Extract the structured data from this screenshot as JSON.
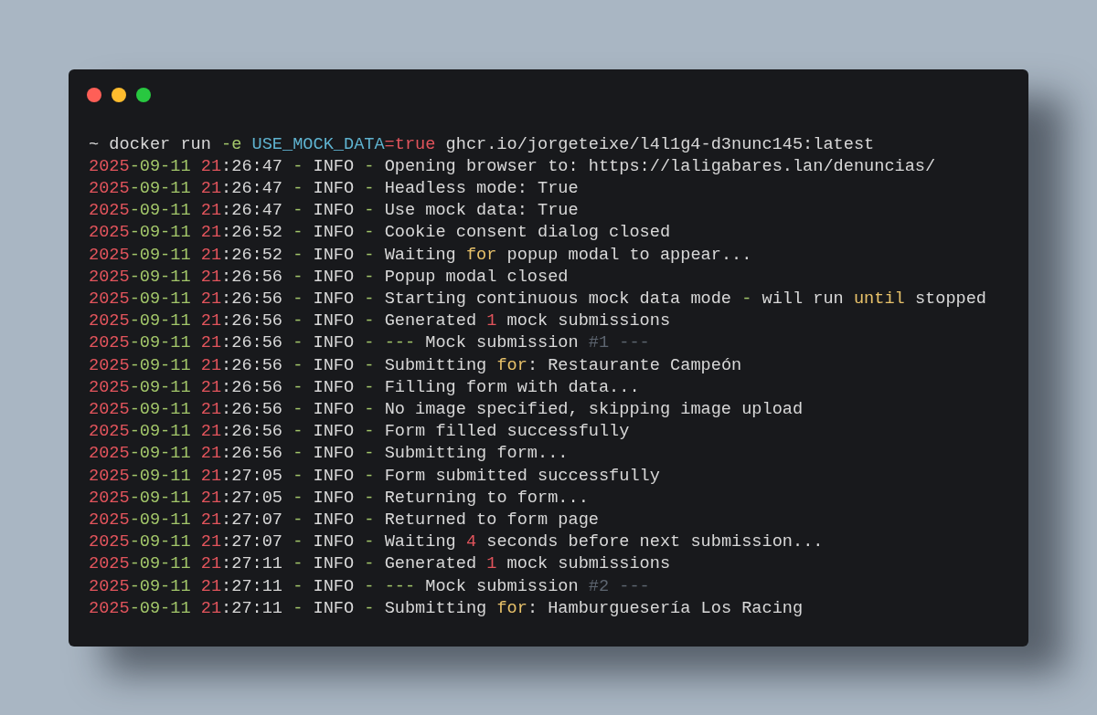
{
  "window": {
    "controls": [
      {
        "color": "#fe5f57"
      },
      {
        "color": "#febc2e"
      },
      {
        "color": "#28c840"
      }
    ]
  },
  "terminal": {
    "lines": [
      {
        "tokens": [
          {
            "kind": "plain",
            "text": "~ docker run "
          },
          {
            "kind": "op",
            "text": "-e "
          },
          {
            "kind": "var",
            "text": "USE_MOCK_DATA"
          },
          {
            "kind": "num",
            "text": "=true"
          },
          {
            "kind": "plain",
            "text": " ghcr.io/jorgeteixe/l4l1g4-d3nunc145:latest"
          }
        ]
      },
      {
        "tokens": [
          {
            "kind": "num",
            "text": "2025"
          },
          {
            "kind": "op",
            "text": "-09-11 "
          },
          {
            "kind": "num",
            "text": "21"
          },
          {
            "kind": "plain",
            "text": ":26:47 "
          },
          {
            "kind": "op",
            "text": "-"
          },
          {
            "kind": "plain",
            "text": " INFO "
          },
          {
            "kind": "op",
            "text": "-"
          },
          {
            "kind": "plain",
            "text": " Opening browser to: https://laligabares.lan/denuncias/"
          }
        ]
      },
      {
        "tokens": [
          {
            "kind": "num",
            "text": "2025"
          },
          {
            "kind": "op",
            "text": "-09-11 "
          },
          {
            "kind": "num",
            "text": "21"
          },
          {
            "kind": "plain",
            "text": ":26:47 "
          },
          {
            "kind": "op",
            "text": "-"
          },
          {
            "kind": "plain",
            "text": " INFO "
          },
          {
            "kind": "op",
            "text": "-"
          },
          {
            "kind": "plain",
            "text": " Headless mode: True"
          }
        ]
      },
      {
        "tokens": [
          {
            "kind": "num",
            "text": "2025"
          },
          {
            "kind": "op",
            "text": "-09-11 "
          },
          {
            "kind": "num",
            "text": "21"
          },
          {
            "kind": "plain",
            "text": ":26:47 "
          },
          {
            "kind": "op",
            "text": "-"
          },
          {
            "kind": "plain",
            "text": " INFO "
          },
          {
            "kind": "op",
            "text": "-"
          },
          {
            "kind": "plain",
            "text": " Use mock data: True"
          }
        ]
      },
      {
        "tokens": [
          {
            "kind": "num",
            "text": "2025"
          },
          {
            "kind": "op",
            "text": "-09-11 "
          },
          {
            "kind": "num",
            "text": "21"
          },
          {
            "kind": "plain",
            "text": ":26:52 "
          },
          {
            "kind": "op",
            "text": "-"
          },
          {
            "kind": "plain",
            "text": " INFO "
          },
          {
            "kind": "op",
            "text": "-"
          },
          {
            "kind": "plain",
            "text": " Cookie consent dialog closed"
          }
        ]
      },
      {
        "tokens": [
          {
            "kind": "num",
            "text": "2025"
          },
          {
            "kind": "op",
            "text": "-09-11 "
          },
          {
            "kind": "num",
            "text": "21"
          },
          {
            "kind": "plain",
            "text": ":26:52 "
          },
          {
            "kind": "op",
            "text": "-"
          },
          {
            "kind": "plain",
            "text": " INFO "
          },
          {
            "kind": "op",
            "text": "-"
          },
          {
            "kind": "plain",
            "text": " Waiting "
          },
          {
            "kind": "kw",
            "text": "for"
          },
          {
            "kind": "plain",
            "text": " popup modal to appear..."
          }
        ]
      },
      {
        "tokens": [
          {
            "kind": "num",
            "text": "2025"
          },
          {
            "kind": "op",
            "text": "-09-11 "
          },
          {
            "kind": "num",
            "text": "21"
          },
          {
            "kind": "plain",
            "text": ":26:56 "
          },
          {
            "kind": "op",
            "text": "-"
          },
          {
            "kind": "plain",
            "text": " INFO "
          },
          {
            "kind": "op",
            "text": "-"
          },
          {
            "kind": "plain",
            "text": " Popup modal closed"
          }
        ]
      },
      {
        "tokens": [
          {
            "kind": "num",
            "text": "2025"
          },
          {
            "kind": "op",
            "text": "-09-11 "
          },
          {
            "kind": "num",
            "text": "21"
          },
          {
            "kind": "plain",
            "text": ":26:56 "
          },
          {
            "kind": "op",
            "text": "-"
          },
          {
            "kind": "plain",
            "text": " INFO "
          },
          {
            "kind": "op",
            "text": "-"
          },
          {
            "kind": "plain",
            "text": " Starting continuous mock data mode "
          },
          {
            "kind": "op",
            "text": "-"
          },
          {
            "kind": "plain",
            "text": " will run "
          },
          {
            "kind": "kw",
            "text": "until"
          },
          {
            "kind": "plain",
            "text": " stopped"
          }
        ]
      },
      {
        "tokens": [
          {
            "kind": "num",
            "text": "2025"
          },
          {
            "kind": "op",
            "text": "-09-11 "
          },
          {
            "kind": "num",
            "text": "21"
          },
          {
            "kind": "plain",
            "text": ":26:56 "
          },
          {
            "kind": "op",
            "text": "-"
          },
          {
            "kind": "plain",
            "text": " INFO "
          },
          {
            "kind": "op",
            "text": "-"
          },
          {
            "kind": "plain",
            "text": " Generated "
          },
          {
            "kind": "num",
            "text": "1"
          },
          {
            "kind": "plain",
            "text": " mock submissions"
          }
        ]
      },
      {
        "tokens": [
          {
            "kind": "num",
            "text": "2025"
          },
          {
            "kind": "op",
            "text": "-09-11 "
          },
          {
            "kind": "num",
            "text": "21"
          },
          {
            "kind": "plain",
            "text": ":26:56 "
          },
          {
            "kind": "op",
            "text": "-"
          },
          {
            "kind": "plain",
            "text": " INFO "
          },
          {
            "kind": "op",
            "text": "- ---"
          },
          {
            "kind": "plain",
            "text": " Mock submission "
          },
          {
            "kind": "comment",
            "text": "#1 ---"
          }
        ]
      },
      {
        "tokens": [
          {
            "kind": "num",
            "text": "2025"
          },
          {
            "kind": "op",
            "text": "-09-11 "
          },
          {
            "kind": "num",
            "text": "21"
          },
          {
            "kind": "plain",
            "text": ":26:56 "
          },
          {
            "kind": "op",
            "text": "-"
          },
          {
            "kind": "plain",
            "text": " INFO "
          },
          {
            "kind": "op",
            "text": "-"
          },
          {
            "kind": "plain",
            "text": " Submitting "
          },
          {
            "kind": "kw",
            "text": "for"
          },
          {
            "kind": "plain",
            "text": ": Restaurante Campeón"
          }
        ]
      },
      {
        "tokens": [
          {
            "kind": "num",
            "text": "2025"
          },
          {
            "kind": "op",
            "text": "-09-11 "
          },
          {
            "kind": "num",
            "text": "21"
          },
          {
            "kind": "plain",
            "text": ":26:56 "
          },
          {
            "kind": "op",
            "text": "-"
          },
          {
            "kind": "plain",
            "text": " INFO "
          },
          {
            "kind": "op",
            "text": "-"
          },
          {
            "kind": "plain",
            "text": " Filling form with data..."
          }
        ]
      },
      {
        "tokens": [
          {
            "kind": "num",
            "text": "2025"
          },
          {
            "kind": "op",
            "text": "-09-11 "
          },
          {
            "kind": "num",
            "text": "21"
          },
          {
            "kind": "plain",
            "text": ":26:56 "
          },
          {
            "kind": "op",
            "text": "-"
          },
          {
            "kind": "plain",
            "text": " INFO "
          },
          {
            "kind": "op",
            "text": "-"
          },
          {
            "kind": "plain",
            "text": " No image specified, skipping image upload"
          }
        ]
      },
      {
        "tokens": [
          {
            "kind": "num",
            "text": "2025"
          },
          {
            "kind": "op",
            "text": "-09-11 "
          },
          {
            "kind": "num",
            "text": "21"
          },
          {
            "kind": "plain",
            "text": ":26:56 "
          },
          {
            "kind": "op",
            "text": "-"
          },
          {
            "kind": "plain",
            "text": " INFO "
          },
          {
            "kind": "op",
            "text": "-"
          },
          {
            "kind": "plain",
            "text": " Form filled successfully"
          }
        ]
      },
      {
        "tokens": [
          {
            "kind": "num",
            "text": "2025"
          },
          {
            "kind": "op",
            "text": "-09-11 "
          },
          {
            "kind": "num",
            "text": "21"
          },
          {
            "kind": "plain",
            "text": ":26:56 "
          },
          {
            "kind": "op",
            "text": "-"
          },
          {
            "kind": "plain",
            "text": " INFO "
          },
          {
            "kind": "op",
            "text": "-"
          },
          {
            "kind": "plain",
            "text": " Submitting form..."
          }
        ]
      },
      {
        "tokens": [
          {
            "kind": "num",
            "text": "2025"
          },
          {
            "kind": "op",
            "text": "-09-11 "
          },
          {
            "kind": "num",
            "text": "21"
          },
          {
            "kind": "plain",
            "text": ":27:05 "
          },
          {
            "kind": "op",
            "text": "-"
          },
          {
            "kind": "plain",
            "text": " INFO "
          },
          {
            "kind": "op",
            "text": "-"
          },
          {
            "kind": "plain",
            "text": " Form submitted successfully"
          }
        ]
      },
      {
        "tokens": [
          {
            "kind": "num",
            "text": "2025"
          },
          {
            "kind": "op",
            "text": "-09-11 "
          },
          {
            "kind": "num",
            "text": "21"
          },
          {
            "kind": "plain",
            "text": ":27:05 "
          },
          {
            "kind": "op",
            "text": "-"
          },
          {
            "kind": "plain",
            "text": " INFO "
          },
          {
            "kind": "op",
            "text": "-"
          },
          {
            "kind": "plain",
            "text": " Returning to form..."
          }
        ]
      },
      {
        "tokens": [
          {
            "kind": "num",
            "text": "2025"
          },
          {
            "kind": "op",
            "text": "-09-11 "
          },
          {
            "kind": "num",
            "text": "21"
          },
          {
            "kind": "plain",
            "text": ":27:07 "
          },
          {
            "kind": "op",
            "text": "-"
          },
          {
            "kind": "plain",
            "text": " INFO "
          },
          {
            "kind": "op",
            "text": "-"
          },
          {
            "kind": "plain",
            "text": " Returned to form page"
          }
        ]
      },
      {
        "tokens": [
          {
            "kind": "num",
            "text": "2025"
          },
          {
            "kind": "op",
            "text": "-09-11 "
          },
          {
            "kind": "num",
            "text": "21"
          },
          {
            "kind": "plain",
            "text": ":27:07 "
          },
          {
            "kind": "op",
            "text": "-"
          },
          {
            "kind": "plain",
            "text": " INFO "
          },
          {
            "kind": "op",
            "text": "-"
          },
          {
            "kind": "plain",
            "text": " Waiting "
          },
          {
            "kind": "num",
            "text": "4"
          },
          {
            "kind": "plain",
            "text": " seconds before next submission..."
          }
        ]
      },
      {
        "tokens": [
          {
            "kind": "num",
            "text": "2025"
          },
          {
            "kind": "op",
            "text": "-09-11 "
          },
          {
            "kind": "num",
            "text": "21"
          },
          {
            "kind": "plain",
            "text": ":27:11 "
          },
          {
            "kind": "op",
            "text": "-"
          },
          {
            "kind": "plain",
            "text": " INFO "
          },
          {
            "kind": "op",
            "text": "-"
          },
          {
            "kind": "plain",
            "text": " Generated "
          },
          {
            "kind": "num",
            "text": "1"
          },
          {
            "kind": "plain",
            "text": " mock submissions"
          }
        ]
      },
      {
        "tokens": [
          {
            "kind": "num",
            "text": "2025"
          },
          {
            "kind": "op",
            "text": "-09-11 "
          },
          {
            "kind": "num",
            "text": "21"
          },
          {
            "kind": "plain",
            "text": ":27:11 "
          },
          {
            "kind": "op",
            "text": "-"
          },
          {
            "kind": "plain",
            "text": " INFO "
          },
          {
            "kind": "op",
            "text": "- ---"
          },
          {
            "kind": "plain",
            "text": " Mock submission "
          },
          {
            "kind": "comment",
            "text": "#2 ---"
          }
        ]
      },
      {
        "tokens": [
          {
            "kind": "num",
            "text": "2025"
          },
          {
            "kind": "op",
            "text": "-09-11 "
          },
          {
            "kind": "num",
            "text": "21"
          },
          {
            "kind": "plain",
            "text": ":27:11 "
          },
          {
            "kind": "op",
            "text": "-"
          },
          {
            "kind": "plain",
            "text": " INFO "
          },
          {
            "kind": "op",
            "text": "-"
          },
          {
            "kind": "plain",
            "text": " Submitting "
          },
          {
            "kind": "kw",
            "text": "for"
          },
          {
            "kind": "plain",
            "text": ": Hamburguesería Los Racing"
          }
        ]
      }
    ]
  }
}
